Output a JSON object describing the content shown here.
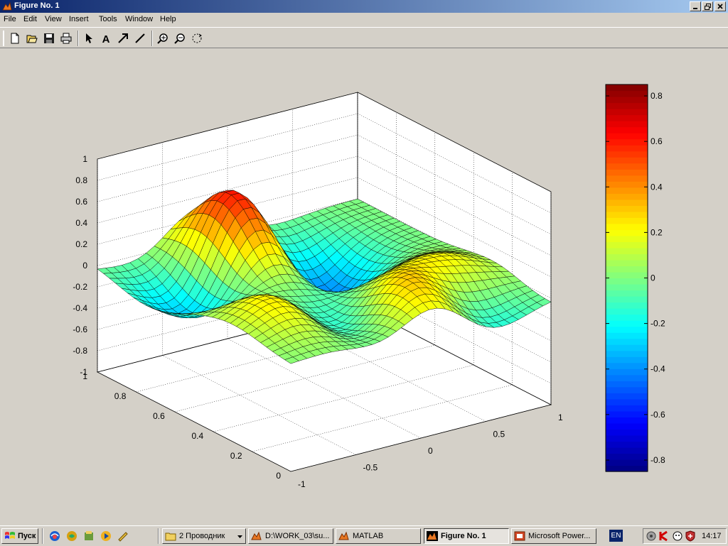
{
  "window": {
    "title": "Figure No. 1",
    "controls": [
      "minimize",
      "restore",
      "close"
    ]
  },
  "menu": [
    "File",
    "Edit",
    "View",
    "Insert",
    "Tools",
    "Window",
    "Help"
  ],
  "toolbar": {
    "buttons": [
      "new-figure-icon",
      "open-file-icon",
      "save-icon",
      "print-icon",
      "edit-plot-arrow-icon",
      "insert-text-icon",
      "insert-arrow-icon",
      "insert-line-icon",
      "zoom-in-icon",
      "zoom-out-icon",
      "rotate-3d-icon"
    ]
  },
  "chart_data": {
    "type": "surface",
    "surface_grid": "32x32 mesh over x in [-1,1], y in [0,1]",
    "surface_peaks": [
      {
        "x": -0.25,
        "y": 0.8,
        "z": 0.85
      },
      {
        "x": 0.6,
        "y": 0.25,
        "z": 0.35
      },
      {
        "x": 0.1,
        "y": 0.15,
        "z": 0.45
      },
      {
        "x": -0.6,
        "y": 0.3,
        "z": 0.35
      }
    ],
    "surface_troughs": [
      {
        "x": -0.6,
        "y": 0.75,
        "z": -0.5
      },
      {
        "x": 0.25,
        "y": 0.7,
        "z": -0.5
      },
      {
        "x": -0.25,
        "y": 0.25,
        "z": -0.4
      },
      {
        "x": 0.55,
        "y": 0.1,
        "z": -0.35
      }
    ],
    "xlim": [
      -1,
      1
    ],
    "ylim": [
      0,
      1
    ],
    "zlim": [
      -1,
      1
    ],
    "x_ticks": [
      "-1",
      "-0.5",
      "0",
      "0.5",
      "1"
    ],
    "y_ticks": [
      "0",
      "0.2",
      "0.4",
      "0.6",
      "0.8",
      "1"
    ],
    "z_ticks": [
      "1",
      "0.8",
      "0.6",
      "0.4",
      "0.2",
      "0",
      "-0.2",
      "-0.4",
      "-0.6",
      "-0.8",
      "-1"
    ],
    "grid": true,
    "colormap": "jet",
    "colorbar": {
      "range": [
        -0.85,
        0.85
      ],
      "ticks": [
        "0.8",
        "0.6",
        "0.4",
        "0.2",
        "0",
        "-0.2",
        "-0.4",
        "-0.6",
        "-0.8"
      ],
      "placement": "right"
    }
  },
  "taskbar": {
    "start_label": "Пуск",
    "quicklaunch": [
      "browser-icon",
      "outlook-icon",
      "app-icon",
      "media-icon",
      "tool-icon"
    ],
    "tasks": [
      {
        "label": "2 Проводник",
        "icon": "folder-icon",
        "active": false
      },
      {
        "label": "D:\\WORK_03\\su...",
        "icon": "matlab-icon",
        "active": false
      },
      {
        "label": "MATLAB",
        "icon": "matlab-icon",
        "active": false
      },
      {
        "label": "Figure No. 1",
        "icon": "matlab-icon",
        "active": true
      },
      {
        "label": "Microsoft Power...",
        "icon": "powerpoint-icon",
        "active": false
      }
    ],
    "language": "EN",
    "tray_icons": [
      "network-icon",
      "antivirus-icon",
      "messenger-icon",
      "shield-icon"
    ],
    "clock": "14:17"
  }
}
